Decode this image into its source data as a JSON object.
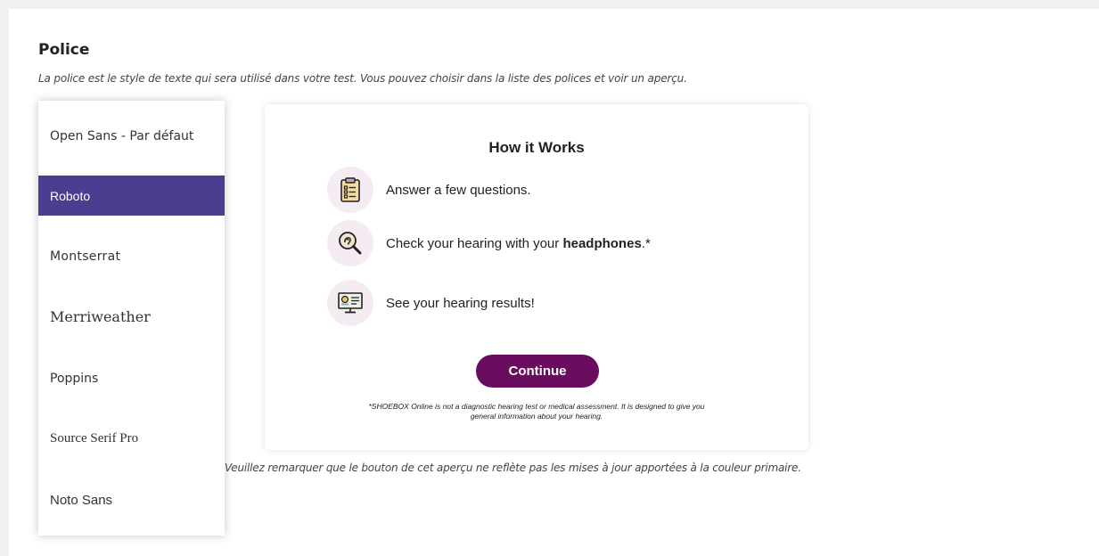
{
  "section": {
    "title": "Police",
    "description": "La police est le style de texte qui sera utilisé dans votre test. Vous pouvez choisir dans la liste des polices et voir un aperçu.",
    "note": "Veuillez remarquer que le bouton de cet aperçu ne reflète pas les mises à jour apportées à la couleur primaire."
  },
  "font_list": {
    "items": [
      {
        "label": "Open Sans - Par défaut",
        "selected": false
      },
      {
        "label": "Roboto",
        "selected": true
      },
      {
        "label": "Montserrat",
        "selected": false
      },
      {
        "label": "Merriweather",
        "selected": false
      },
      {
        "label": "Poppins",
        "selected": false
      },
      {
        "label": "Source Serif Pro",
        "selected": false
      },
      {
        "label": "Noto Sans",
        "selected": false
      }
    ]
  },
  "preview": {
    "title": "How it Works",
    "steps": [
      {
        "icon": "clipboard-checklist-icon",
        "text": "Answer a few questions."
      },
      {
        "icon": "ear-magnifier-icon",
        "text_before": "Check your hearing with your ",
        "text_bold": "headphones",
        "text_after": ".*"
      },
      {
        "icon": "monitor-results-icon",
        "text": "See your hearing results!"
      }
    ],
    "continue_label": "Continue",
    "disclaimer_line1": "*SHOEBOX Online is not a diagnostic hearing test or medical assessment. It is designed to give you",
    "disclaimer_line2": "general information about your hearing."
  },
  "colors": {
    "selected_bg": "#4b3e91",
    "button_bg": "#6a0d5f",
    "icon_circle": "#f4ecf2"
  }
}
